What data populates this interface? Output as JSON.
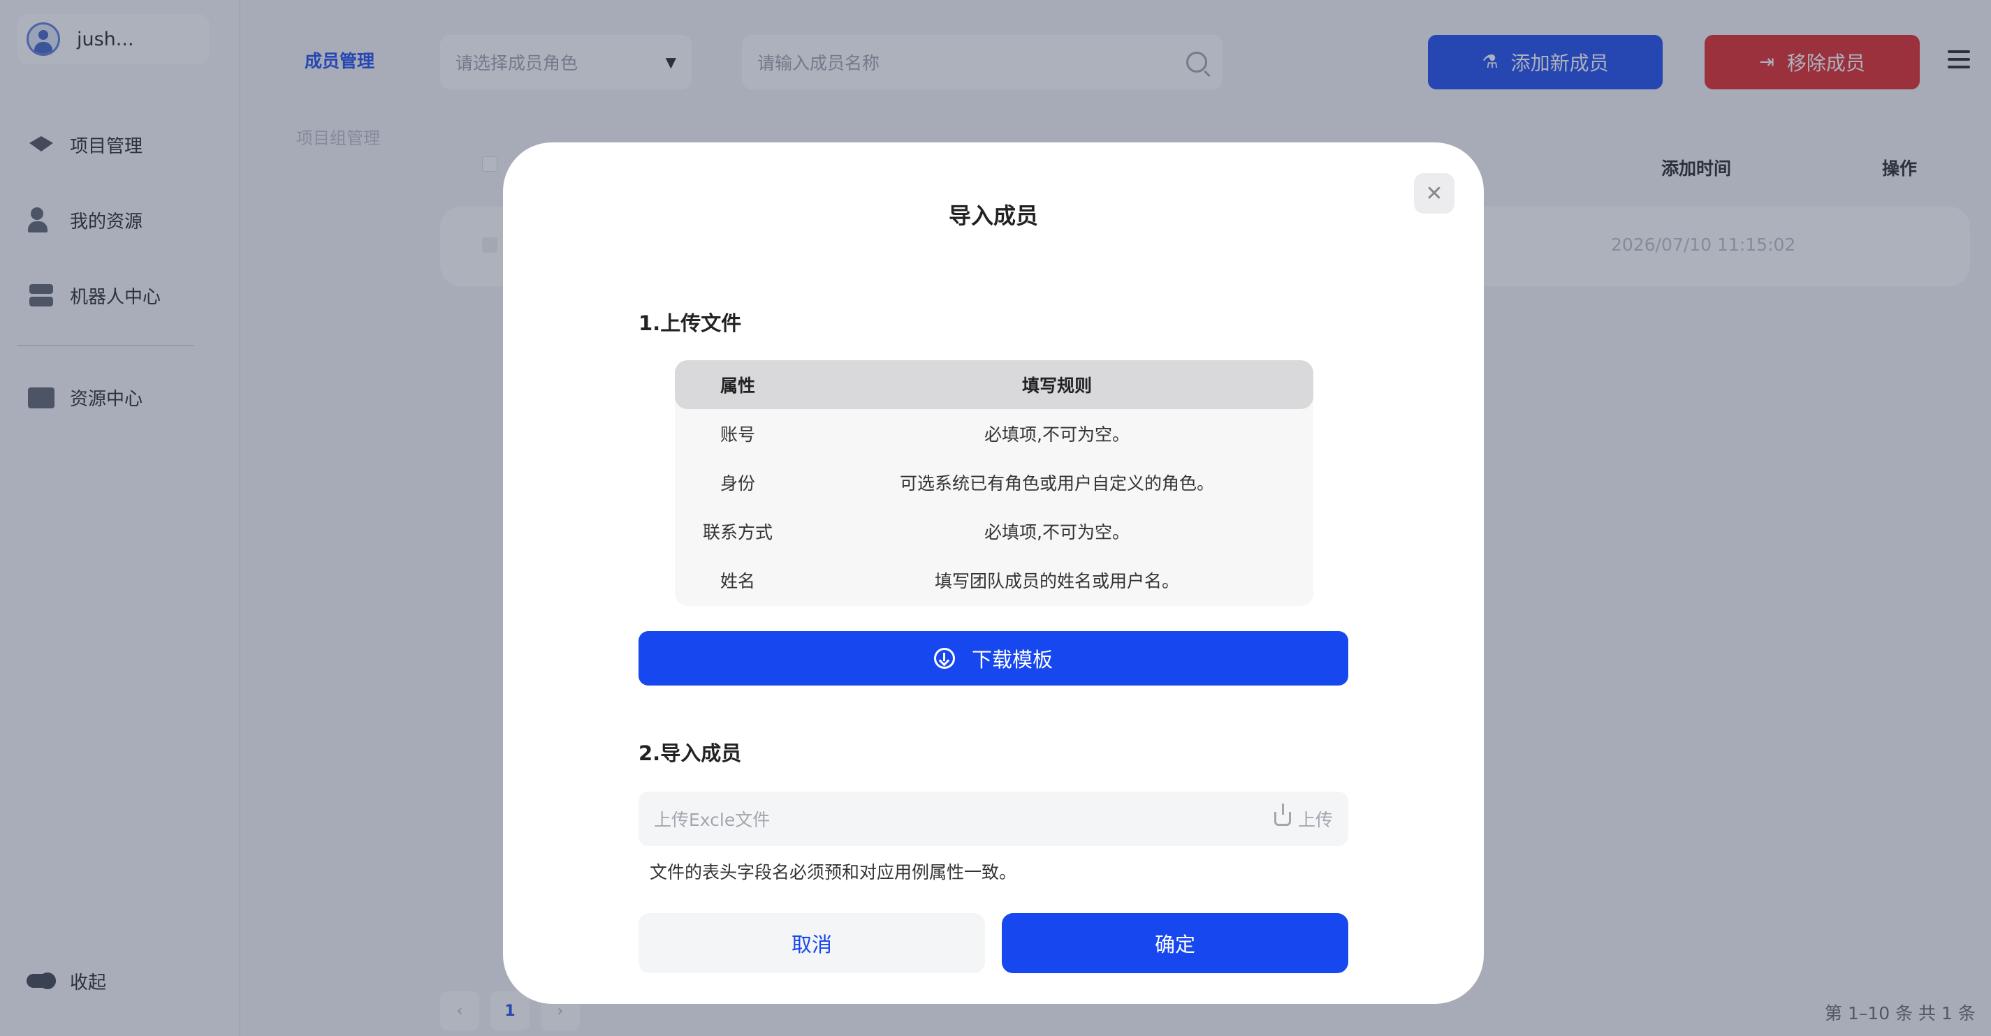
{
  "sidebar": {
    "user_name": "jush...",
    "items": [
      {
        "label": "项目管理",
        "icon": "layers-icon"
      },
      {
        "label": "我的资源",
        "icon": "person-icon"
      },
      {
        "label": "机器人中心",
        "icon": "server-icon"
      },
      {
        "label": "资源中心",
        "icon": "folder-icon"
      }
    ],
    "collapse_label": "收起"
  },
  "toolbar": {
    "title": "成员管理",
    "role_placeholder": "请选择成员角色",
    "search_placeholder": "请输入成员名称",
    "add_label": "添加新成员",
    "remove_label": "移除成员"
  },
  "breadcrumb": "项目组管理",
  "table": {
    "headers": [
      "添加时间",
      "操作"
    ],
    "rows": [
      {
        "time": "2026/07/10 11:15:02"
      }
    ]
  },
  "pagination": {
    "current_page": "1",
    "total_text": "第 1–10 条  共 1 条"
  },
  "modal": {
    "title": "导入成员",
    "step1_label": "1.上传文件",
    "rules_table": {
      "headers": [
        "属性",
        "填写规则"
      ],
      "rows": [
        {
          "attr": "账号",
          "rule": "必填项,不可为空。"
        },
        {
          "attr": "身份",
          "rule": "可选系统已有角色或用户自定义的角色。"
        },
        {
          "attr": "联系方式",
          "rule": "必填项,不可为空。"
        },
        {
          "attr": "姓名",
          "rule": "填写团队成员的姓名或用户名。"
        }
      ]
    },
    "download_label": "下载模板",
    "step2_label": "2.导入成员",
    "upload_placeholder": "上传Excle文件",
    "upload_button": "上传",
    "hint": "文件的表头字段名必须预和对应用例属性一致。",
    "cancel_label": "取消",
    "confirm_label": "确定"
  },
  "colors": {
    "primary": "#1747ee",
    "danger": "#e02424"
  }
}
